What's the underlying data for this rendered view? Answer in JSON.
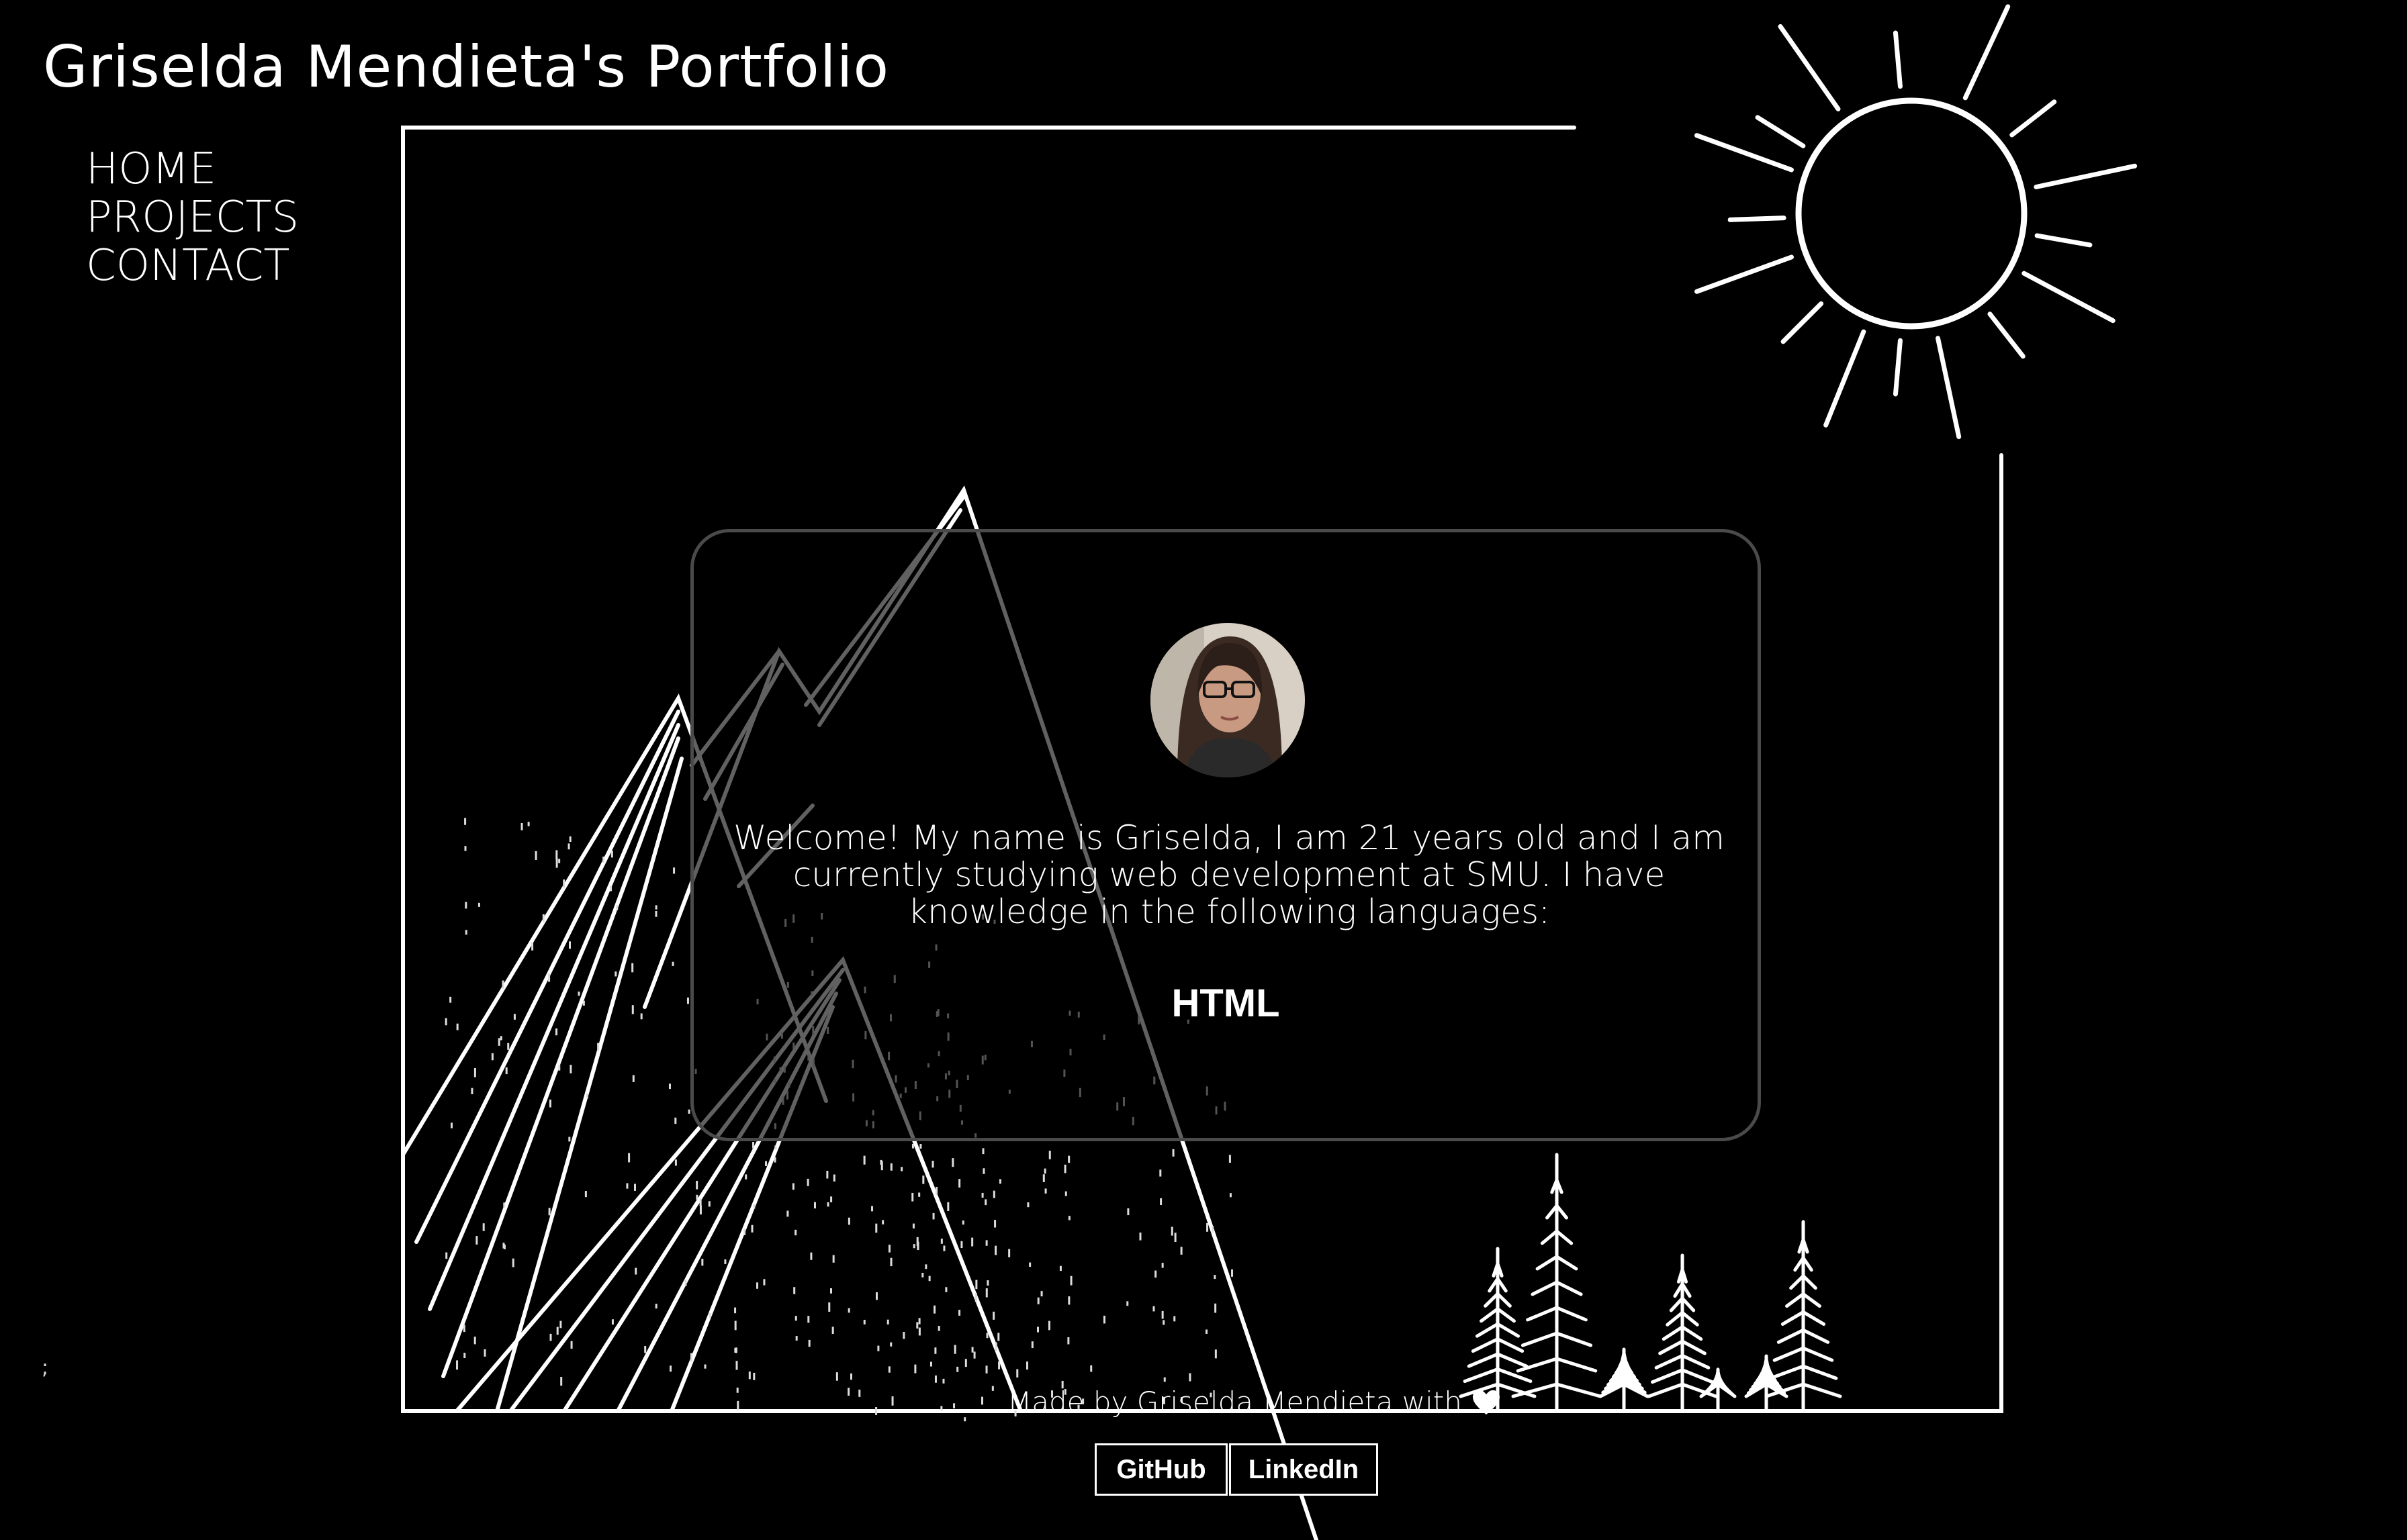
{
  "header": {
    "title": "Griselda Mendieta's Portfolio"
  },
  "nav": {
    "items": [
      {
        "label": "HOME"
      },
      {
        "label": "PROJECTS"
      },
      {
        "label": "CONTACT"
      }
    ]
  },
  "stray_text": ";",
  "card": {
    "intro": "Welcome! My name is Griselda, I am 21 years old and I am currently studying web development at SMU. I have knowledge in the following languages:",
    "language": "HTML"
  },
  "footer": {
    "credit": "Made by Griselda Mendieta with",
    "heart_icon": "heart-icon",
    "links": [
      {
        "label": "GitHub"
      },
      {
        "label": "LinkedIn"
      }
    ]
  },
  "colors": {
    "background": "#000000",
    "line": "#ffffff",
    "card_border": "#4a4a4a"
  }
}
